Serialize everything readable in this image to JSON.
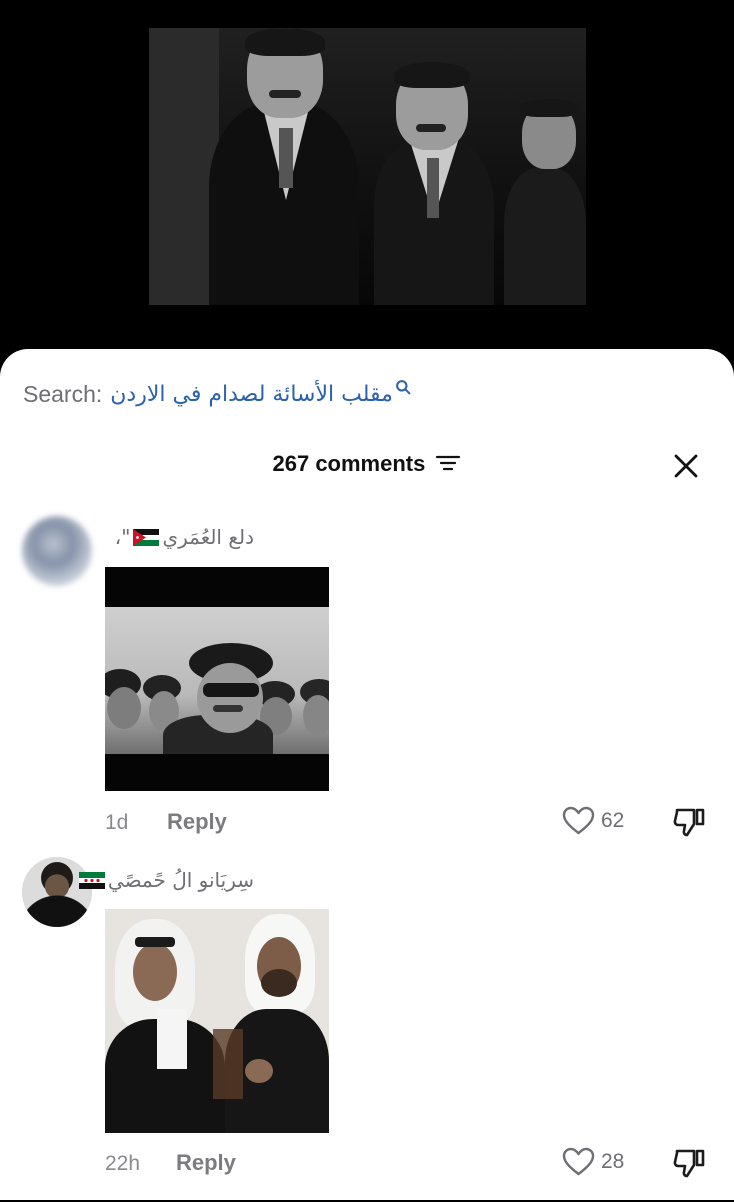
{
  "video": {
    "alt": "black and white archival video frame"
  },
  "search": {
    "label": "Search:",
    "query": "مقلب الأسائة لصدام في الاردن",
    "icon": "search-icon",
    "color": "#2a62ad"
  },
  "comments_header": {
    "count_text": "267 comments",
    "filter_icon": "filter-icon",
    "close_icon": "close-icon"
  },
  "comments": [
    {
      "username": "دلع العُمَري",
      "flag": "jordan-flag",
      "suffix": "\"،",
      "time": "1d",
      "reply": "Reply",
      "likes": "62"
    },
    {
      "username": "سِريَانو الُ حًمصًي",
      "flag": "syria-flag",
      "suffix": "",
      "time": "22h",
      "reply": "Reply",
      "likes": "28"
    }
  ]
}
